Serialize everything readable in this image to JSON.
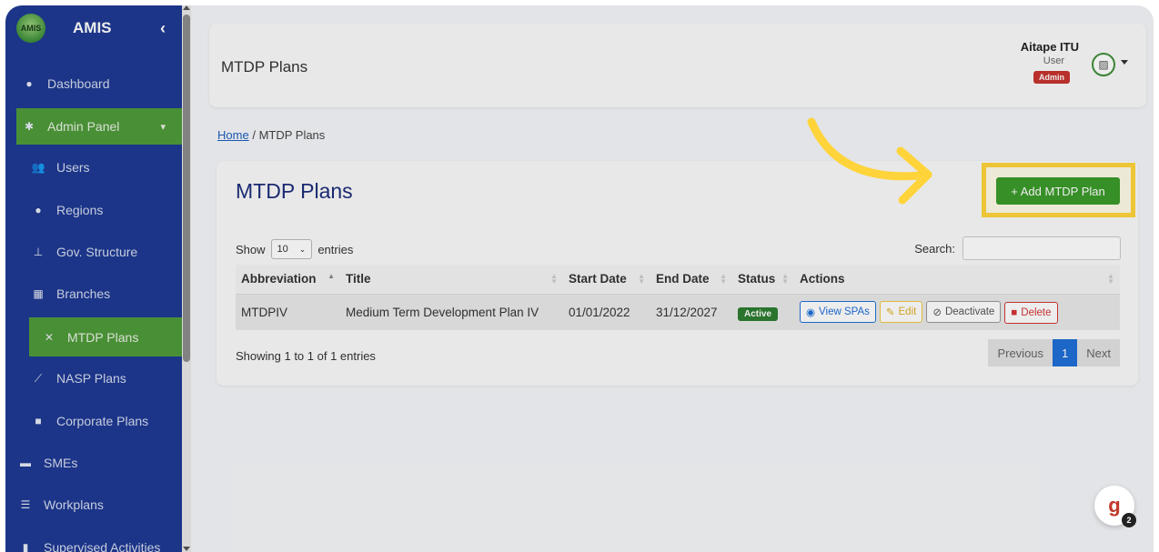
{
  "sidebar": {
    "brand_logo": "AMIS",
    "brand_name": "AMIS",
    "collapse_icon": "chevron-left-icon",
    "items": [
      {
        "label": "Dashboard",
        "icon": "palette-icon"
      },
      {
        "label": "Admin Panel",
        "icon": "gear-icon"
      },
      {
        "label": "Users",
        "icon": "users-icon"
      },
      {
        "label": "Regions",
        "icon": "map-pin-icon"
      },
      {
        "label": "Gov. Structure",
        "icon": "sitemap-icon"
      },
      {
        "label": "Branches",
        "icon": "building-icon"
      },
      {
        "label": "MTDP Plans",
        "icon": "network-icon"
      },
      {
        "label": "NASP Plans",
        "icon": "chart-line-icon"
      },
      {
        "label": "Corporate Plans",
        "icon": "briefcase-icon"
      },
      {
        "label": "SMEs",
        "icon": "store-icon"
      },
      {
        "label": "Workplans",
        "icon": "list-check-icon"
      },
      {
        "label": "Supervised Activities",
        "icon": "clipboard-icon"
      }
    ]
  },
  "header": {
    "title": "MTDP Plans",
    "user_name": "Aitape ITU",
    "user_role": "User",
    "user_badge": "Admin"
  },
  "breadcrumb": {
    "home": "Home",
    "separator": "/",
    "current": "MTDP Plans"
  },
  "card": {
    "title": "MTDP Plans",
    "add_button": "+ Add MTDP Plan",
    "show_label": "Show",
    "entries_value": "10",
    "entries_label": "entries",
    "search_label": "Search:",
    "search_value": ""
  },
  "table": {
    "columns": [
      "Abbreviation",
      "Title",
      "Start Date",
      "End Date",
      "Status",
      "Actions"
    ],
    "rows": [
      {
        "abbreviation": "MTDPIV",
        "title": "Medium Term Development Plan IV",
        "start": "01/01/2022",
        "end": "31/12/2027",
        "status": "Active"
      }
    ],
    "actions": {
      "view": "View SPAs",
      "edit": "Edit",
      "deactivate": "Deactivate",
      "delete": "Delete"
    }
  },
  "footer": {
    "info": "Showing 1 to 1 of 1 entries",
    "prev": "Previous",
    "page": "1",
    "next": "Next"
  },
  "help_widget": {
    "letter": "g",
    "count": "2"
  },
  "colors": {
    "sidebar": "#1f3a93",
    "active": "#4f9a3a",
    "highlight": "#ffd43b",
    "add_button": "#3c9a2b"
  }
}
